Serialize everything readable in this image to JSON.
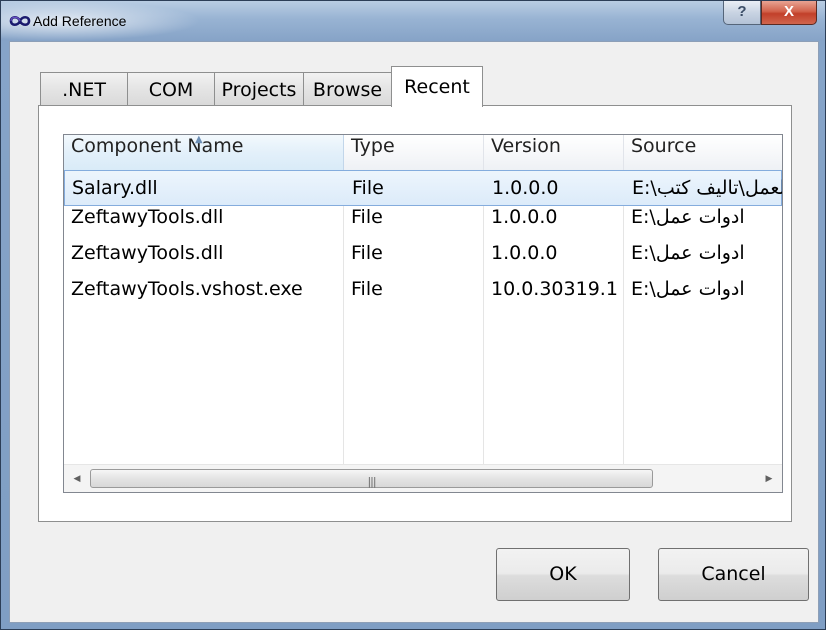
{
  "window": {
    "title": "Add Reference",
    "help_label": "?",
    "close_label": "X"
  },
  "tabs": [
    {
      "label": ".NET",
      "active": false
    },
    {
      "label": "COM",
      "active": false
    },
    {
      "label": "Projects",
      "active": false
    },
    {
      "label": "Browse",
      "active": false
    },
    {
      "label": "Recent",
      "active": true
    }
  ],
  "list": {
    "columns": [
      "Component Name",
      "Type",
      "Version",
      "Source"
    ],
    "sorted_column": "Component Name",
    "rows": [
      {
        "name": "Salary.dll",
        "type": "File",
        "version": "1.0.0.0",
        "source": "E:\\العمل\\تاليف كتب",
        "selected": true
      },
      {
        "name": "ZeftawyTools.dll",
        "type": "File",
        "version": "1.0.0.0",
        "source": "E:\\ادوات عمل",
        "selected": false
      },
      {
        "name": "ZeftawyTools.dll",
        "type": "File",
        "version": "1.0.0.0",
        "source": "E:\\ادوات عمل",
        "selected": false
      },
      {
        "name": "ZeftawyTools.vshost.exe",
        "type": "File",
        "version": "10.0.30319.1",
        "source": "E:\\ادوات عمل",
        "selected": false
      }
    ],
    "scroll_position": 0.0
  },
  "buttons": {
    "ok_label": "OK",
    "cancel_label": "Cancel"
  },
  "icons": {
    "app": "infinity-icon",
    "scroll_left": "arrow-left-icon",
    "scroll_right": "arrow-right-icon",
    "sort": "sort-ascending-icon"
  },
  "colors": {
    "close_button": "#c2402a",
    "selection": "#dcebfa",
    "selection_border": "#84acdd",
    "window_frame": "#86a3c7"
  }
}
